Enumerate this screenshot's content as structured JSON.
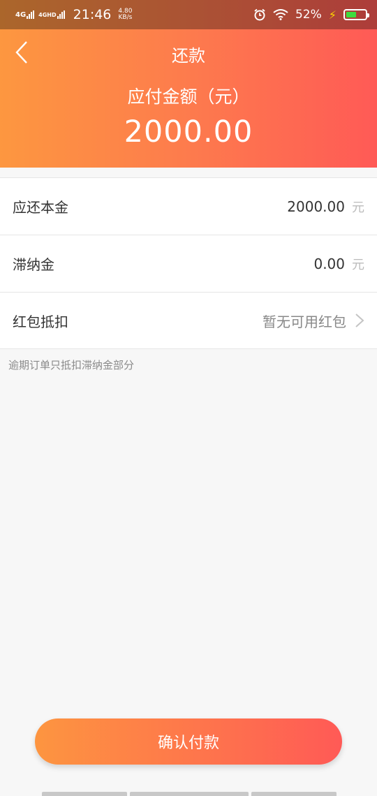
{
  "status_bar": {
    "net1": "4G",
    "net2": "4GHD",
    "time": "21:46",
    "speed_value": "4.80",
    "speed_unit": "KB/s",
    "battery": "52%"
  },
  "header": {
    "title": "还款",
    "amount_label": "应付金额（元）",
    "amount_value": "2000.00"
  },
  "rows": [
    {
      "label": "应还本金",
      "value": "2000.00",
      "unit": "元"
    },
    {
      "label": "滞纳金",
      "value": "0.00",
      "unit": "元"
    },
    {
      "label": "红包抵扣",
      "hint": "暂无可用红包"
    }
  ],
  "note": "逾期订单只抵扣滞纳金部分",
  "confirm_label": "确认付款",
  "colors": {
    "gradient_start": "#fd9740",
    "gradient_end": "#ff5a56"
  }
}
